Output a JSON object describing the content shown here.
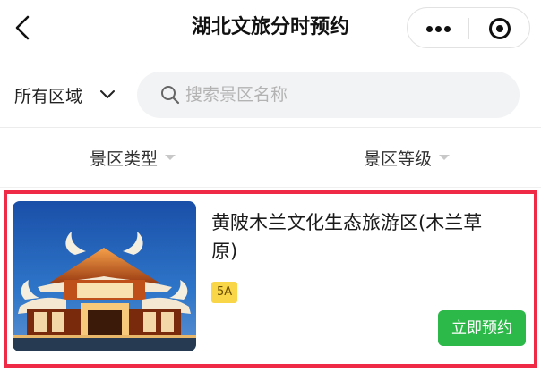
{
  "nav": {
    "title": "湖北文旅分时预约",
    "back_icon": "chevron-left-icon",
    "more_icon": "ellipsis-icon",
    "close_icon": "target-circle-icon"
  },
  "filter": {
    "region_label": "所有区域",
    "region_icon": "chevron-down-icon",
    "search_icon": "search-icon",
    "search_placeholder": "搜索景区名称",
    "search_value": ""
  },
  "sort": {
    "type_label": "景区类型",
    "level_label": "景区等级",
    "caret_icon": "caret-down-icon"
  },
  "results": [
    {
      "title": "黄陂木兰文化生态旅游区(木兰草原)",
      "level_badge": "5A",
      "book_label": "立即预约",
      "image_icon": "scenic-gate-photo",
      "highlight_color": "#ee2a47",
      "button_color": "#2db84a",
      "badge_color": "#f9d548"
    }
  ]
}
